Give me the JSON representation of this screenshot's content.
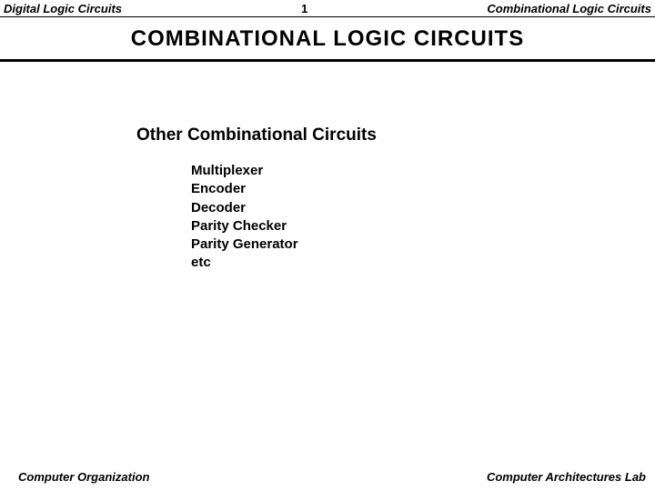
{
  "header": {
    "left": "Digital Logic Circuits",
    "center": "1",
    "right": "Combinational Logic Circuits"
  },
  "title": "COMBINATIONAL  LOGIC  CIRCUITS",
  "section_heading": "Other Combinational Circuits",
  "items": {
    "i0": "Multiplexer",
    "i1": "Encoder",
    "i2": "Decoder",
    "i3": "Parity Checker",
    "i4": "Parity Generator",
    "i5": "etc"
  },
  "footer": {
    "left": "Computer Organization",
    "right": "Computer Architectures Lab"
  }
}
